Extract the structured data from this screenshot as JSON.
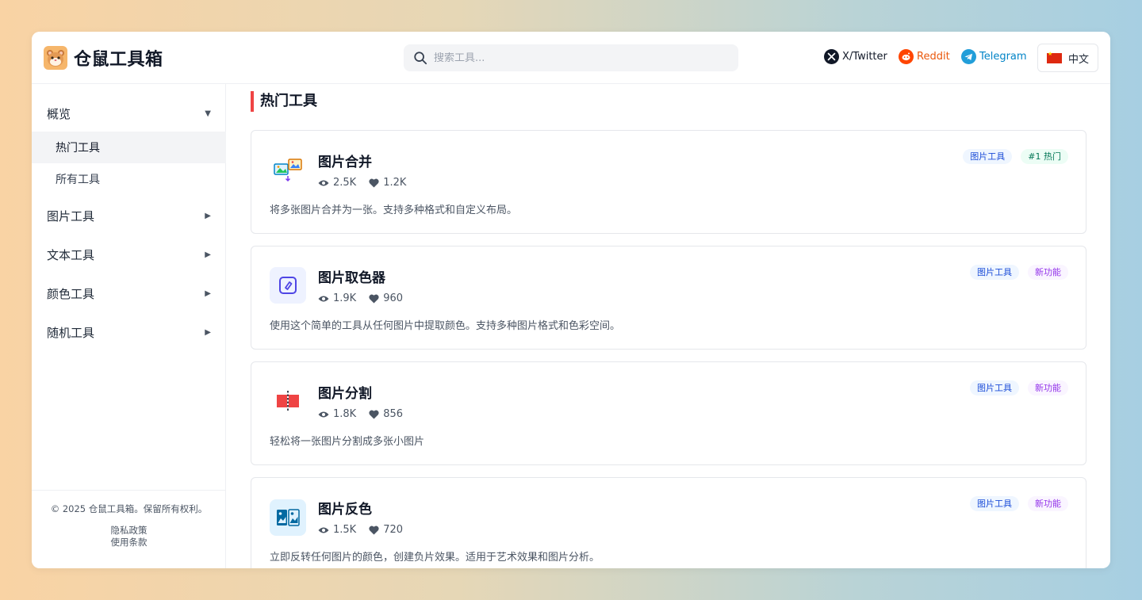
{
  "app": {
    "name": "仓鼠工具箱"
  },
  "search": {
    "placeholder": "搜索工具..."
  },
  "social": {
    "twitter": "X/Twitter",
    "reddit": "Reddit",
    "telegram": "Telegram"
  },
  "language": {
    "label": "中文"
  },
  "sidebar": {
    "overview": "概览",
    "sub": {
      "hot": "热门工具",
      "all": "所有工具"
    },
    "groups": [
      "图片工具",
      "文本工具",
      "颜色工具",
      "随机工具"
    ]
  },
  "footer": {
    "copyright": "© 2025 仓鼠工具箱。保留所有权利。",
    "privacy": "隐私政策",
    "terms": "使用条款"
  },
  "main": {
    "section_title": "热门工具",
    "cards": [
      {
        "title": "图片合并",
        "views": "2.5K",
        "likes": "1.2K",
        "desc": "将多张图片合并为一张。支持多种格式和自定义布局。",
        "tags": [
          {
            "text": "图片工具",
            "kind": "cat"
          },
          {
            "text": "#1 热门",
            "kind": "hot"
          }
        ],
        "icon": "image-merge-icon"
      },
      {
        "title": "图片取色器",
        "views": "1.9K",
        "likes": "960",
        "desc": "使用这个简单的工具从任何图片中提取颜色。支持多种图片格式和色彩空间。",
        "tags": [
          {
            "text": "图片工具",
            "kind": "cat"
          },
          {
            "text": "新功能",
            "kind": "new"
          }
        ],
        "icon": "color-picker-icon"
      },
      {
        "title": "图片分割",
        "views": "1.8K",
        "likes": "856",
        "desc": "轻松将一张图片分割成多张小图片",
        "tags": [
          {
            "text": "图片工具",
            "kind": "cat"
          },
          {
            "text": "新功能",
            "kind": "new"
          }
        ],
        "icon": "image-split-icon"
      },
      {
        "title": "图片反色",
        "views": "1.5K",
        "likes": "720",
        "desc": "立即反转任何图片的颜色，创建负片效果。适用于艺术效果和图片分析。",
        "tags": [
          {
            "text": "图片工具",
            "kind": "cat"
          },
          {
            "text": "新功能",
            "kind": "new"
          }
        ],
        "icon": "image-invert-icon"
      }
    ]
  }
}
